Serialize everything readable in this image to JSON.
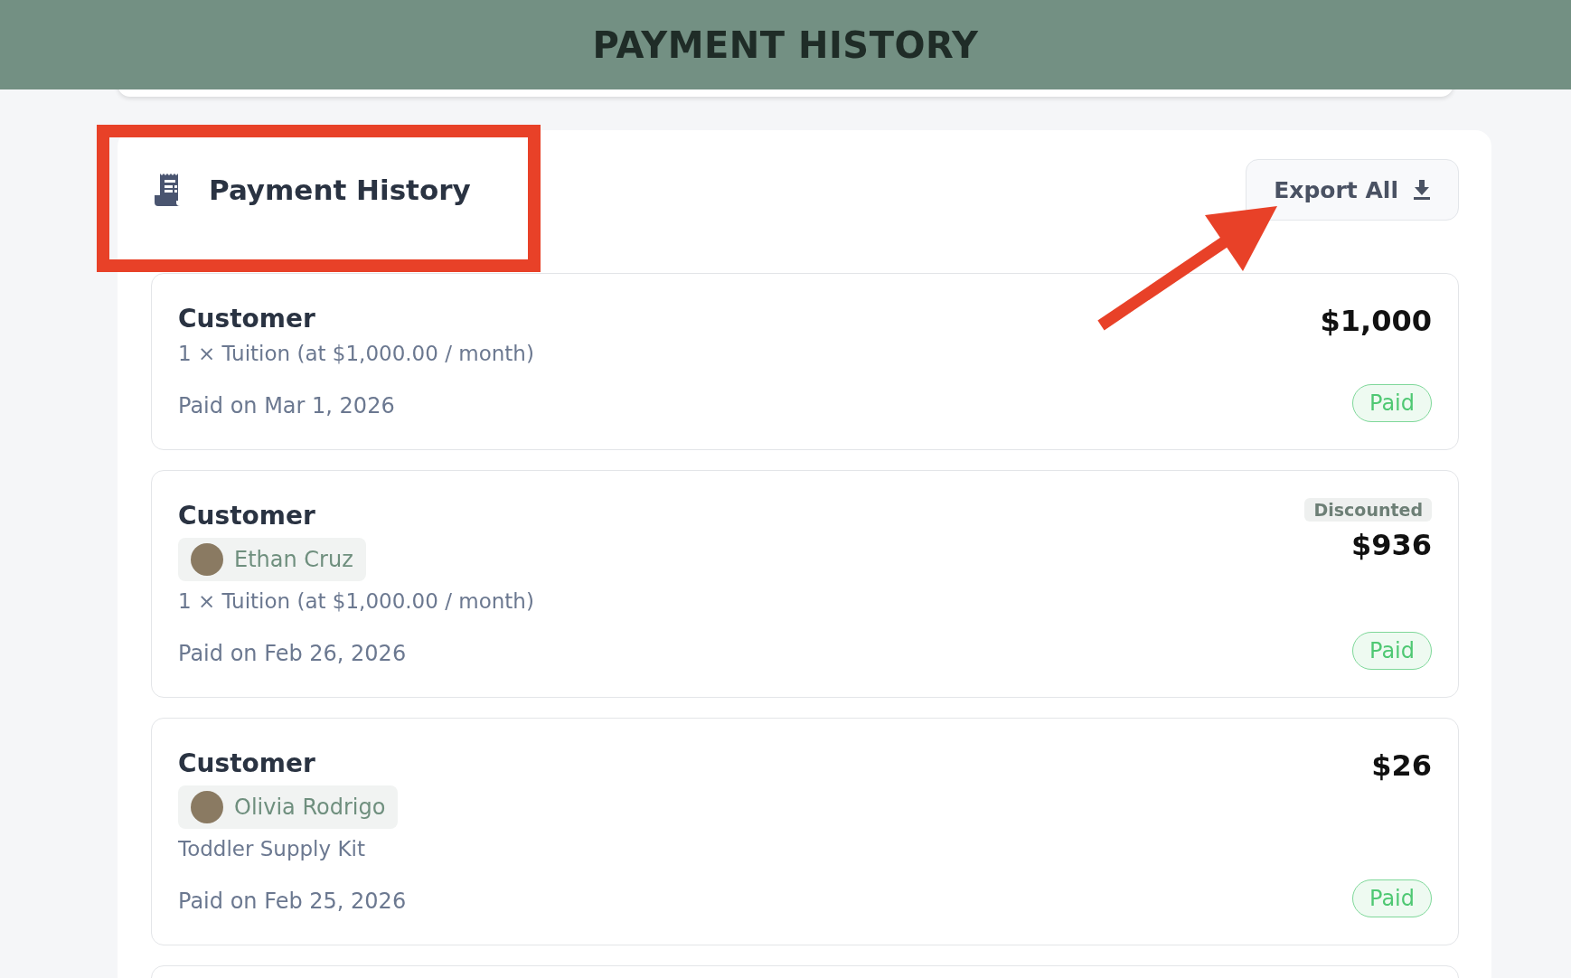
{
  "header": {
    "title": "PAYMENT HISTORY"
  },
  "panel": {
    "title": "Payment History",
    "export_button": "Export All"
  },
  "payments": [
    {
      "customer": "Customer",
      "description": "1 × Tuition (at $1,000.00 / month)",
      "paid_on": "Paid on Mar 1, 2026",
      "amount": "$1,000",
      "status": "Paid"
    },
    {
      "customer": "Customer",
      "child": "Ethan Cruz",
      "description": "1 × Tuition (at $1,000.00 / month)",
      "paid_on": "Paid on Feb 26, 2026",
      "amount": "$936",
      "discount_badge": "Discounted",
      "status": "Paid"
    },
    {
      "customer": "Customer",
      "child": "Olivia Rodrigo",
      "description": "Toddler Supply Kit",
      "paid_on": "Paid on Feb 25, 2026",
      "amount": "$26",
      "status": "Paid"
    }
  ]
}
